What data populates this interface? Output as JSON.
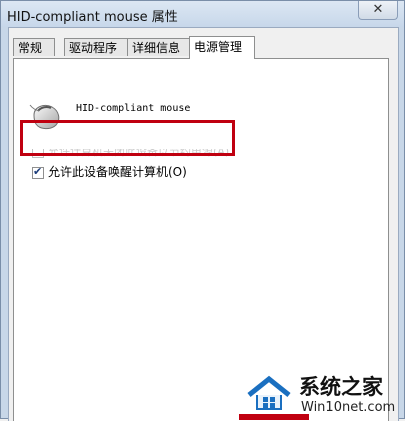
{
  "window": {
    "title": "HID-compliant mouse 属性",
    "close_label": "✕"
  },
  "tabs": [
    {
      "label": "常规",
      "active": false
    },
    {
      "label": "驱动程序",
      "active": false
    },
    {
      "label": "详细信息",
      "active": false
    },
    {
      "label": "电源管理",
      "active": true
    }
  ],
  "device": {
    "name": "HID-compliant mouse",
    "icon": "mouse-icon"
  },
  "options": {
    "allow_power_off_label": "允许计算机关闭此设备以节约电源(A)",
    "allow_power_off_checked": false,
    "allow_power_off_enabled": false,
    "allow_wake_label": "允许此设备唤醒计算机(O)",
    "allow_wake_checked": true
  },
  "watermark": {
    "title": "系统之家",
    "url": "Win10net.com"
  },
  "colors": {
    "highlight": "#c00010",
    "titlebar": "#c7d7ea"
  }
}
